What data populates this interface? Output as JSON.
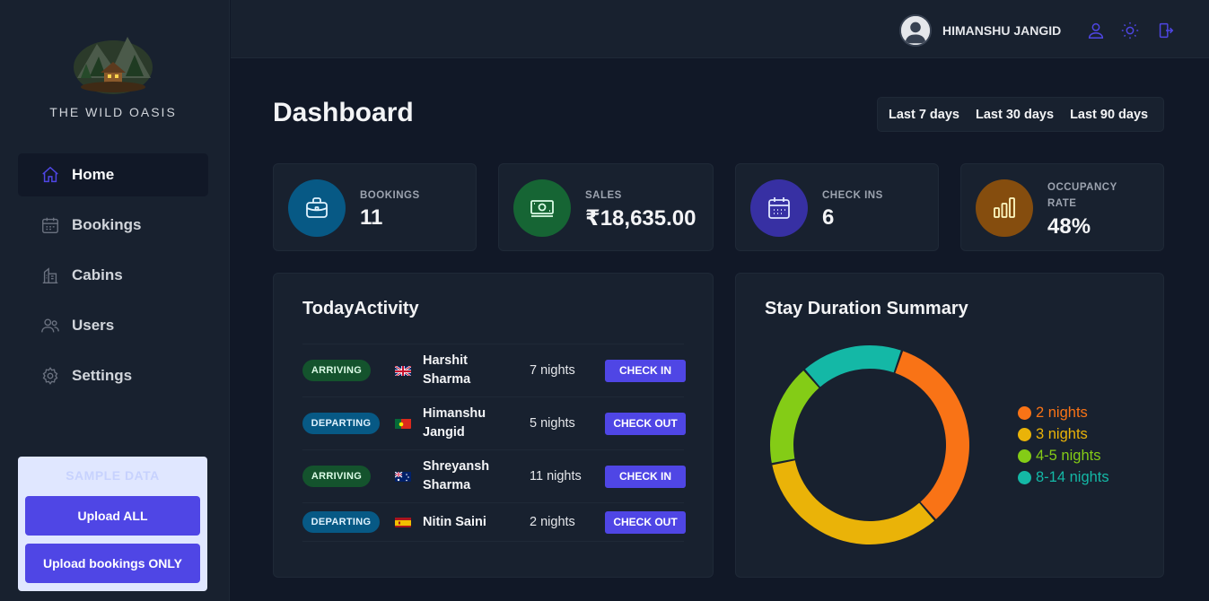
{
  "brand": {
    "name": "THE WILD OASIS"
  },
  "sidebar": {
    "items": [
      {
        "label": "Home",
        "icon": "home-icon",
        "active": true
      },
      {
        "label": "Bookings",
        "icon": "calendar-icon",
        "active": false
      },
      {
        "label": "Cabins",
        "icon": "cabin-icon",
        "active": false
      },
      {
        "label": "Users",
        "icon": "users-icon",
        "active": false
      },
      {
        "label": "Settings",
        "icon": "gear-icon",
        "active": false
      }
    ],
    "sample": {
      "title": "SAMPLE DATA",
      "upload_all": "Upload ALL",
      "upload_bookings": "Upload bookings ONLY"
    }
  },
  "header": {
    "user_name": "HIMANSHU JANGID",
    "icons": [
      "user-icon",
      "sun-icon",
      "logout-icon"
    ]
  },
  "main": {
    "title": "Dashboard",
    "filters": [
      "Last 7 days",
      "Last 30 days",
      "Last 90 days"
    ],
    "stats": [
      {
        "label": "BOOKINGS",
        "value": "11",
        "color": "#075985",
        "icon": "briefcase-icon"
      },
      {
        "label": "SALES",
        "value": "₹18,635.00",
        "color": "#166534",
        "icon": "banknotes-icon"
      },
      {
        "label": "CHECK INS",
        "value": "6",
        "color": "#3730a3",
        "icon": "calendar-days-icon"
      },
      {
        "label": "OCCUPANCY",
        "label2": "RATE",
        "value": "48%",
        "color": "#854d0e",
        "icon": "chart-bar-icon"
      }
    ],
    "activity": {
      "title": "TodayActivity",
      "rows": [
        {
          "status": "ARRIVING",
          "flag": "gb",
          "guest_first": "Harshit",
          "guest_last": "Sharma",
          "nights": "7 nights",
          "action": "CHECK IN"
        },
        {
          "status": "DEPARTING",
          "flag": "pt",
          "guest_first": "Himanshu",
          "guest_last": "Jangid",
          "nights": "5 nights",
          "action": "CHECK OUT"
        },
        {
          "status": "ARRIVING",
          "flag": "au",
          "guest_first": "Shreyansh",
          "guest_last": "Sharma",
          "nights": "11 nights",
          "action": "CHECK IN"
        },
        {
          "status": "DEPARTING",
          "flag": "es",
          "guest_first": "Nitin Saini",
          "guest_last": "",
          "nights": "2 nights",
          "action": "CHECK OUT"
        }
      ]
    },
    "duration": {
      "title": "Stay Duration Summary"
    }
  },
  "chart_data": {
    "type": "pie",
    "title": "Stay Duration Summary",
    "categories": [
      "2 nights",
      "3 nights",
      "4-5 nights",
      "8-14 nights"
    ],
    "values": [
      4,
      4,
      2,
      2
    ],
    "colors": [
      "#f97316",
      "#eab308",
      "#84cc16",
      "#14b8a6"
    ],
    "legend": "right"
  }
}
